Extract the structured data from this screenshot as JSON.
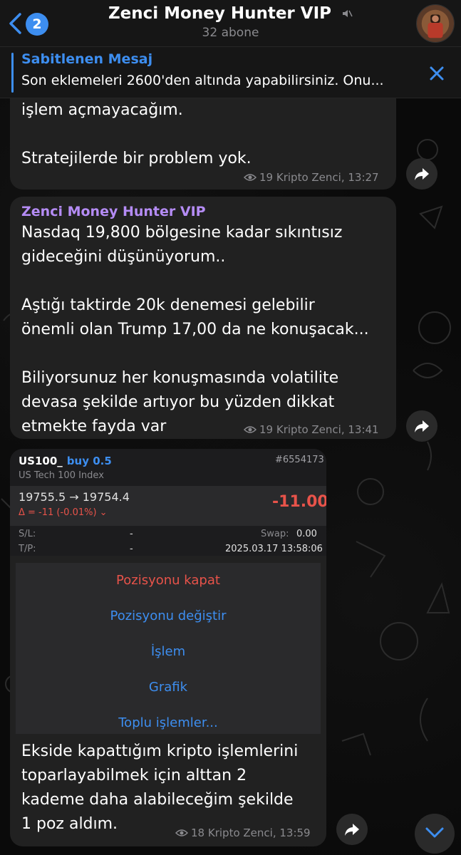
{
  "header": {
    "back_badge": "2",
    "title": "Zenci Money Hunter VIP",
    "subtitle": "32 abone"
  },
  "pinned": {
    "title": "Sabitlenen Mesaj",
    "text": "Son eklemeleri 2600'den altında yapabilirsiniz. Onu..."
  },
  "messages": [
    {
      "text": "işlem açmayacağım.\n\nStratejilerde bir problem yok.",
      "views": "19",
      "author": "Kripto Zenci",
      "time": "13:27"
    },
    {
      "sender": "Zenci Money Hunter VIP",
      "text": "Nasdaq 19,800 bölgesine kadar sıkıntısız\ngideceğini düşünüyorum..\n\nAştığı taktirde 20k denemesi gelebilir\nönemli olan Trump 17,00 da ne konuşacak...\n\nBiliyorsunuz her konuşmasında volatilite\ndevasa şekilde artıyor bu yüzden dikkat\netmekte fayda var",
      "views": "19",
      "author": "Kripto Zenci",
      "time": "13:41"
    },
    {
      "text": "Ekside kapattığım kripto işlemlerini\ntoparlayabilmek için alttan 2\nkademe daha alabileceğim şekilde\n1 poz aldım.",
      "views": "18",
      "author": "Kripto Zenci",
      "time": "13:59"
    }
  ],
  "trade": {
    "symbol": "US100_",
    "side": "buy 0.5",
    "id": "#6554173",
    "name": "US Tech 100 Index",
    "prices": "19755.5 → 19754.4",
    "delta": "Δ = -11 (-0.01%) ⌄",
    "pl": "-11.00",
    "sl_label": "S/L:",
    "sl_value": "-",
    "swap_label": "Swap:",
    "swap_value": "0.00",
    "tp_label": "T/P:",
    "tp_value": "-",
    "datetime": "2025.03.17 13:58:06"
  },
  "action_sheet": {
    "items": [
      "Pozisyonu kapat",
      "Pozisyonu değiştir",
      "İşlem",
      "Grafik",
      "Toplu işlemler..."
    ]
  },
  "colors": {
    "accent": "#3d8ef0",
    "sender": "#b58cf5",
    "negative": "#e8534a"
  }
}
